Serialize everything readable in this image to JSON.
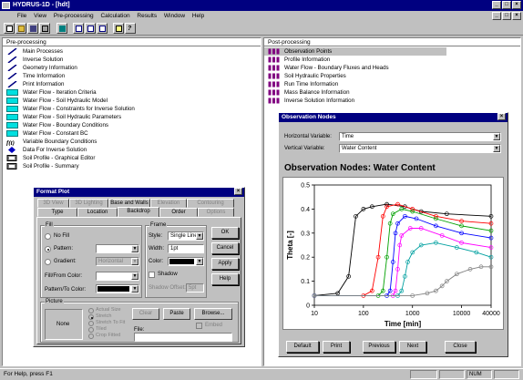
{
  "app": {
    "title": "HYDRUS-1D - [hdt]",
    "menu": [
      "File",
      "View",
      "Pre-processing",
      "Calculation",
      "Results",
      "Window",
      "Help"
    ]
  },
  "toolbar": {
    "icons": [
      "new-icon",
      "open-icon",
      "save-icon",
      "print-icon",
      "run-icon",
      "tile-horizontal-icon",
      "tile-vertical-icon",
      "cascade-icon",
      "about-icon",
      "help-icon"
    ]
  },
  "preprocessing": {
    "header": "Pre-processing",
    "items": [
      {
        "label": "Main Processes",
        "icon": "pencil-icon"
      },
      {
        "label": "Inverse Solution",
        "icon": "pencil-icon"
      },
      {
        "label": "Geometry Information",
        "icon": "pencil-icon"
      },
      {
        "label": "Time Information",
        "icon": "pencil-icon"
      },
      {
        "label": "Print Information",
        "icon": "pencil-icon"
      },
      {
        "label": "Water Flow - Iteration Criteria",
        "icon": "table-icon"
      },
      {
        "label": "Water Flow - Soil Hydraulic Model",
        "icon": "table-icon"
      },
      {
        "label": "Water Flow - Constraints for Inverse Solution",
        "icon": "table-icon"
      },
      {
        "label": "Water Flow - Soil Hydraulic Parameters",
        "icon": "table-icon"
      },
      {
        "label": "Water Flow - Boundary Conditions",
        "icon": "table-icon"
      },
      {
        "label": "Water Flow - Constant BC",
        "icon": "table-icon"
      },
      {
        "label": "Variable Boundary Conditions",
        "icon": "function-icon",
        "glyph": "f(t)"
      },
      {
        "label": "Data For Inverse Solution",
        "icon": "diamond-icon"
      },
      {
        "label": "Soil Profile - Graphical Editor",
        "icon": "profile-icon"
      },
      {
        "label": "Soil Profile - Summary",
        "icon": "profile-icon"
      }
    ]
  },
  "postprocessing": {
    "header": "Post-processing",
    "items": [
      {
        "label": "Observation Points"
      },
      {
        "label": "Profile Information"
      },
      {
        "label": "Water Flow - Boundary Fluxes and Heads"
      },
      {
        "label": "Soil Hydraulic Properties"
      },
      {
        "label": "Run Time Information"
      },
      {
        "label": "Mass Balance Information"
      },
      {
        "label": "Inverse Solution Information"
      }
    ]
  },
  "observation": {
    "title": "Observation Nodes",
    "horizontal_label": "Horizontal Variable:",
    "horizontal_value": "Time",
    "vertical_label": "Vertical Variable:",
    "vertical_value": "Water Content",
    "chart_title": "Observation Nodes: Water Content",
    "buttons": {
      "default": "Default",
      "print": "Print",
      "previous": "Previous",
      "next": "Next",
      "close": "Close"
    }
  },
  "chart_data": {
    "type": "line",
    "title": "",
    "xlabel": "Time [min]",
    "ylabel": "Theta [-]",
    "x_scale": "log",
    "xlim": [
      10,
      40000
    ],
    "ylim": [
      0,
      0.5
    ],
    "x_ticks": [
      "10",
      "100",
      "1000",
      "10000",
      "40000"
    ],
    "y_ticks": [
      "0",
      "0.1",
      "0.2",
      "0.3",
      "0.4",
      "0.5"
    ],
    "series_colors": [
      "#000000",
      "#ff0000",
      "#00a000",
      "#0000ff",
      "#ff00ff",
      "#00a0a0",
      "#808080"
    ],
    "series": [
      {
        "x": [
          10,
          30,
          50,
          70,
          100,
          150,
          300,
          700,
          1500,
          5000,
          40000
        ],
        "y": [
          0.04,
          0.05,
          0.12,
          0.37,
          0.4,
          0.41,
          0.42,
          0.41,
          0.39,
          0.38,
          0.37
        ]
      },
      {
        "x": [
          10,
          100,
          150,
          200,
          250,
          300,
          500,
          1000,
          3000,
          10000,
          40000
        ],
        "y": [
          0.04,
          0.04,
          0.06,
          0.2,
          0.37,
          0.41,
          0.42,
          0.4,
          0.37,
          0.35,
          0.34
        ]
      },
      {
        "x": [
          10,
          200,
          250,
          300,
          350,
          400,
          600,
          1000,
          3000,
          10000,
          40000
        ],
        "y": [
          0.04,
          0.04,
          0.06,
          0.2,
          0.34,
          0.38,
          0.4,
          0.39,
          0.36,
          0.33,
          0.31
        ]
      },
      {
        "x": [
          10,
          300,
          350,
          400,
          450,
          500,
          700,
          1200,
          3000,
          10000,
          40000
        ],
        "y": [
          0.04,
          0.04,
          0.06,
          0.18,
          0.3,
          0.34,
          0.37,
          0.36,
          0.33,
          0.3,
          0.28
        ]
      },
      {
        "x": [
          10,
          400,
          450,
          500,
          550,
          600,
          900,
          1500,
          4000,
          10000,
          40000
        ],
        "y": [
          0.04,
          0.04,
          0.06,
          0.15,
          0.25,
          0.29,
          0.32,
          0.32,
          0.29,
          0.26,
          0.24
        ]
      },
      {
        "x": [
          10,
          500,
          600,
          700,
          800,
          1000,
          1500,
          3000,
          8000,
          20000,
          40000
        ],
        "y": [
          0.04,
          0.04,
          0.06,
          0.12,
          0.18,
          0.22,
          0.25,
          0.26,
          0.24,
          0.22,
          0.2
        ]
      },
      {
        "x": [
          10,
          1000,
          2000,
          3000,
          4000,
          5000,
          8000,
          15000,
          25000,
          40000
        ],
        "y": [
          0.04,
          0.04,
          0.05,
          0.06,
          0.08,
          0.1,
          0.13,
          0.15,
          0.16,
          0.16
        ]
      }
    ]
  },
  "format_plot": {
    "title": "Format Plot",
    "tabs_row1": [
      "3D View",
      "3D Lighting",
      "Base and Walls",
      "Elevation",
      "Contouring"
    ],
    "tabs_row2": [
      "Type",
      "Location",
      "Backdrop",
      "Order",
      "Options"
    ],
    "fill_group": "Fill",
    "no_fill": "No Fill",
    "pattern": "Pattern:",
    "gradient": "Gradient:",
    "gradient_value": "Horizontal",
    "fill_from_color": "Fill/From Color:",
    "pattern_to_color": "Pattern/To Color:",
    "frame_group": "Frame",
    "style_label": "Style:",
    "style_value": "Single Line",
    "width_label": "Width:",
    "width_value": "1pt",
    "color_label": "Color:",
    "shadow_label": "Shadow",
    "shadow_offset_label": "Shadow Offset:",
    "shadow_offset_value": "5pt",
    "picture_group": "Picture",
    "picture_none": "None",
    "picture_options": [
      "Actual Size",
      "Stretch",
      "Stretch To Fit",
      "Tiled",
      "Crop Fitted"
    ],
    "clear": "Clear",
    "paste": "Paste",
    "browse": "Browse...",
    "embed": "Embed",
    "file_label": "File:",
    "ok": "OK",
    "cancel": "Cancel",
    "apply": "Apply",
    "help": "Help"
  },
  "status": {
    "text": "For Help, press F1",
    "num": "NUM"
  }
}
